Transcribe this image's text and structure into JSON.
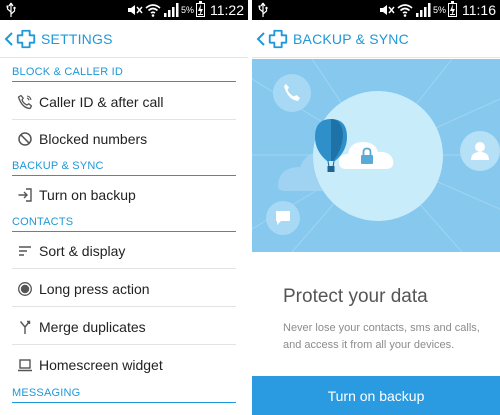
{
  "left_screen": {
    "statusbar": {
      "time": "11:22",
      "battery": "5%",
      "battery_level": 0.05
    },
    "appbar": {
      "title": "SETTINGS"
    },
    "sections": [
      {
        "header": "BLOCK & CALLER ID",
        "items": [
          {
            "label": "Caller ID & after call",
            "icon": "phone-icon"
          },
          {
            "label": "Blocked numbers",
            "icon": "block-icon"
          }
        ]
      },
      {
        "header": "BACKUP & SYNC",
        "items": [
          {
            "label": "Turn on backup",
            "icon": "login-arrow-icon"
          }
        ]
      },
      {
        "header": "CONTACTS",
        "items": [
          {
            "label": "Sort & display",
            "icon": "sort-lines-icon"
          },
          {
            "label": "Long press action",
            "icon": "radio-dot-icon"
          },
          {
            "label": "Merge duplicates",
            "icon": "merge-icon"
          },
          {
            "label": "Homescreen widget",
            "icon": "widget-icon"
          }
        ]
      },
      {
        "header": "MESSAGING",
        "items": []
      }
    ]
  },
  "right_screen": {
    "statusbar": {
      "time": "11:16",
      "battery": "5%",
      "battery_level": 0.05
    },
    "appbar": {
      "title": "BACKUP & SYNC"
    },
    "hero_icons": [
      "phone-icon",
      "cloud-lock-icon",
      "balloon-icon",
      "person-icon",
      "chat-bubble-icon"
    ],
    "title": "Protect your data",
    "description": "Never lose your contacts, sms and calls, and access it from all your devices.",
    "cta_label": "Turn on backup"
  },
  "colors": {
    "accent": "#1e98d8",
    "hero_bg": "#86c8ee",
    "button": "#2a9be0",
    "statusbar": "#000000"
  }
}
